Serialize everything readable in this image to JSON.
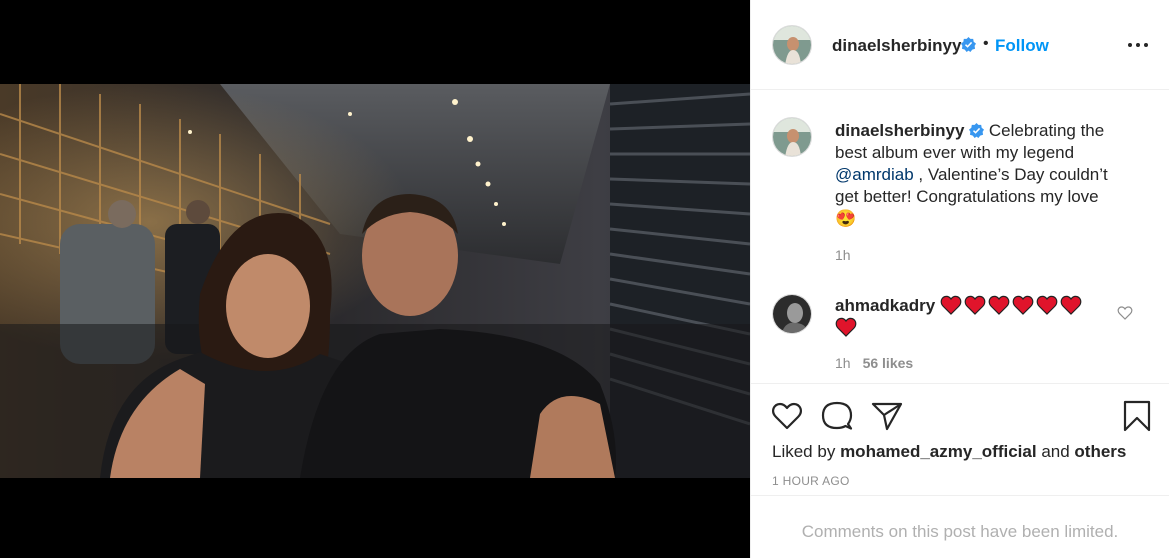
{
  "post": {
    "username": "dinaelsherbinyy",
    "follow_label": "Follow",
    "separator": "•",
    "caption_username": "dinaelsherbinyy",
    "caption_pre": "Celebrating the best album ever with my legend",
    "caption_mention": "@amrdiab",
    "caption_post": ", Valentine’s Day couldn’t get better! Congratulations my love",
    "caption_emoji": "😍",
    "caption_time": "1h",
    "liked_by_prefix": "Liked by",
    "liked_by_user": "mohamed_azmy_official",
    "liked_by_and": "and",
    "liked_by_others": "others",
    "post_time": "1 HOUR AGO",
    "comments_limited": "Comments on this post have been limited."
  },
  "comment": {
    "username": "ahmadkadry",
    "hearts": 7,
    "time": "1h",
    "likes": "56 likes"
  },
  "icons": {
    "verified": "verified-badge-icon",
    "more": "more-options-icon",
    "like": "heart-outline-icon",
    "comment": "comment-bubble-icon",
    "share": "paper-plane-icon",
    "save": "bookmark-icon"
  },
  "colors": {
    "follow": "#0095f6",
    "verified": "#3897f0",
    "heart": "#e0142b",
    "muted": "#8e8e8e"
  }
}
